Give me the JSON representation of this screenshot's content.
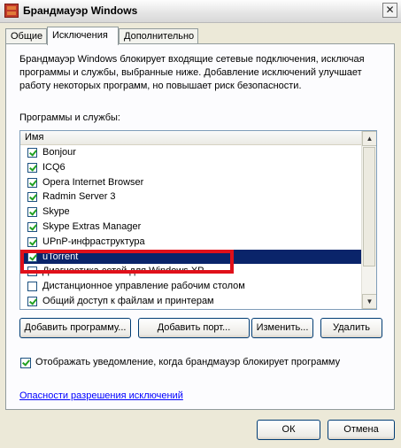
{
  "window": {
    "title": "Брандмауэр Windows",
    "close_glyph": "✕"
  },
  "tabs": [
    {
      "label": "Общие"
    },
    {
      "label": "Исключения"
    },
    {
      "label": "Дополнительно"
    }
  ],
  "description": "Брандмауэр Windows блокирует входящие сетевые подключения, исключая программы и службы, выбранные ниже. Добавление исключений улучшает работу некоторых программ, но повышает риск безопасности.",
  "programs_label": "Программы и службы:",
  "list": {
    "column_header": "Имя",
    "items": [
      {
        "label": "Bonjour",
        "checked": true
      },
      {
        "label": "ICQ6",
        "checked": true
      },
      {
        "label": "Opera Internet Browser",
        "checked": true
      },
      {
        "label": "Radmin Server 3",
        "checked": true
      },
      {
        "label": "Skype",
        "checked": true
      },
      {
        "label": "Skype Extras Manager",
        "checked": true
      },
      {
        "label": "UPnP-инфраструктура",
        "checked": true
      },
      {
        "label": "uTorrent",
        "checked": true,
        "selected": true
      },
      {
        "label": "Диагностика сетей для Windows XP",
        "checked": false
      },
      {
        "label": "Дистанционное управление рабочим столом",
        "checked": false
      },
      {
        "label": "Общий доступ к файлам и принтерам",
        "checked": true
      }
    ]
  },
  "buttons": {
    "add_program": "Добавить программу...",
    "add_port": "Добавить порт...",
    "edit": "Изменить...",
    "delete": "Удалить",
    "ok": "ОК",
    "cancel": "Отмена"
  },
  "notify": {
    "label": "Отображать уведомление, когда брандмауэр блокирует программу",
    "checked": true
  },
  "link_text": "Опасности разрешения исключений",
  "colors": {
    "selection": "#0a246a",
    "highlight_box": "#e0101a",
    "link": "#0000ff"
  }
}
